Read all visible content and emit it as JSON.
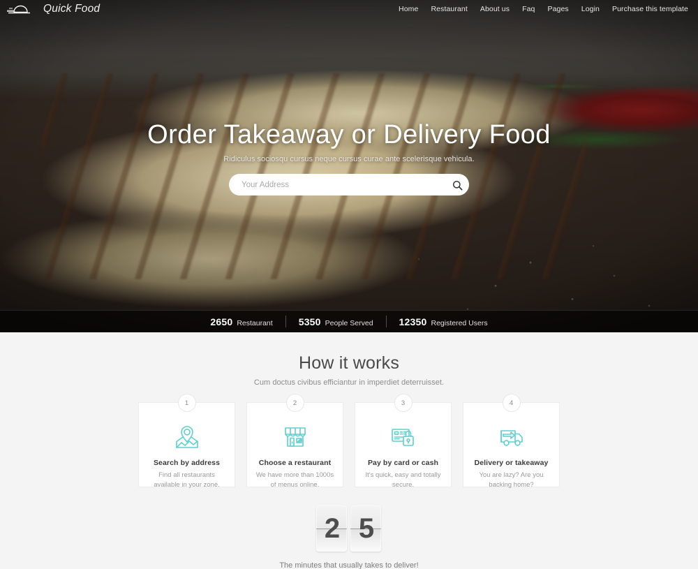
{
  "brand": {
    "name": "Quick Food",
    "logo_icon": "food-dome-logo"
  },
  "nav": {
    "items": [
      {
        "label": "Home",
        "name": "home"
      },
      {
        "label": "Restaurant",
        "name": "restaurant"
      },
      {
        "label": "About us",
        "name": "about-us"
      },
      {
        "label": "Faq",
        "name": "faq"
      },
      {
        "label": "Pages",
        "name": "pages"
      },
      {
        "label": "Login",
        "name": "login"
      },
      {
        "label": "Purchase this template",
        "name": "purchase-this-template"
      }
    ]
  },
  "hero": {
    "title": "Order Takeaway or Delivery Food",
    "subtitle": "Ridiculus sociosqu cursus neque cursus curae ante scelerisque vehicula.",
    "search": {
      "placeholder": "Your Address",
      "value": "",
      "button_icon": "search-icon"
    }
  },
  "stats": [
    {
      "number": "2650",
      "label": "Restaurant"
    },
    {
      "number": "5350",
      "label": "People Served"
    },
    {
      "number": "12350",
      "label": "Registered Users"
    }
  ],
  "how_it_works": {
    "title": "How it works",
    "subtitle": "Cum doctus civibus efficiantur in imperdiet deterruisset.",
    "cards": [
      {
        "badge": "1",
        "icon": "map-pin-icon",
        "title": "Search by address",
        "description": "Find all restaurants available in your zone."
      },
      {
        "badge": "2",
        "icon": "storefront-icon",
        "title": "Choose a restaurant",
        "description": "We have more than 1000s of menus online."
      },
      {
        "badge": "3",
        "icon": "card-lock-icon",
        "title": "Pay by card or cash",
        "description": "It's quick, easy and totally secure."
      },
      {
        "badge": "4",
        "icon": "delivery-truck-icon",
        "title": "Delivery or takeaway",
        "description": "You are lazy? Are you backing home?"
      }
    ]
  },
  "counter": {
    "digits": [
      "2",
      "5"
    ],
    "caption": "The minutes that usually takes to deliver!"
  },
  "colors": {
    "accent_teal": "#5ecfcf",
    "page_bg": "#f4f4f4",
    "card_bg": "#ffffff",
    "heading": "#4a4a4a",
    "muted_text": "#9a9a9a"
  }
}
